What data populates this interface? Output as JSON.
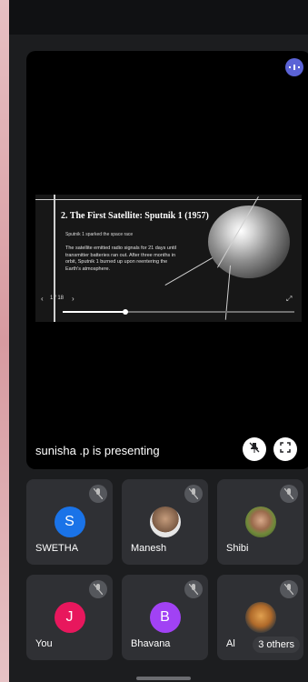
{
  "stage": {
    "presenter_text": "sunisha .p is presenting",
    "slide": {
      "title": "2. The First Satellite: Sputnik 1 (1957)",
      "subtitle": "Sputnik 1 sparked the space race",
      "body": "The satellite emitted radio signals for 21 days until transmitter batteries ran out. After three months in orbit, Sputnik 1 burned up upon reentering the Earth's atmosphere.",
      "page": "1 / 18",
      "progress": 0.27
    },
    "icons": {
      "audio": "audio-level-icon",
      "pin": "unpin-icon",
      "fullscreen": "fullscreen-icon"
    }
  },
  "participants": [
    {
      "name": "SWETHA",
      "initial": "S",
      "color": "#1a73e8",
      "muted": true
    },
    {
      "name": "Manesh",
      "initial": "",
      "color": "#8a6f5a",
      "muted": true,
      "photo": true
    },
    {
      "name": "Shibi",
      "initial": "",
      "color": "#7a8a4a",
      "muted": true,
      "photo": true
    },
    {
      "name": "You",
      "initial": "J",
      "color": "#e8175d",
      "muted": true
    },
    {
      "name": "Bhavana",
      "initial": "B",
      "color": "#a142f4",
      "muted": true
    },
    {
      "name": "Al",
      "initial": "",
      "color": "#c77a2a",
      "muted": true,
      "photo": true
    }
  ],
  "others_chip": "3 others"
}
